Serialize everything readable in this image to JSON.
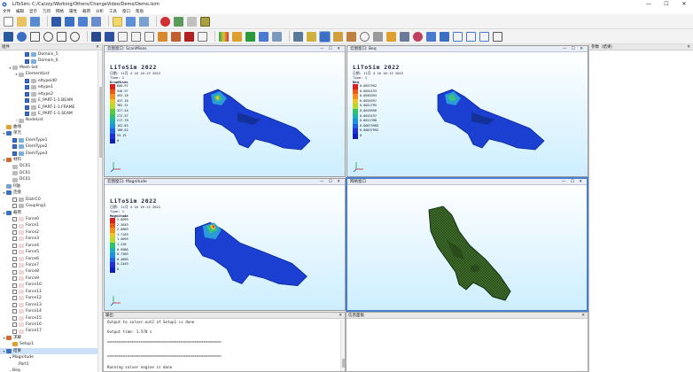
{
  "window": {
    "title": "LiToSim: C:/Ca/zzy/Working/Others/ChangeVideo/Demo/Demo.lsim",
    "min": "—",
    "max": "☐",
    "close": "✕"
  },
  "menu": [
    "文件",
    "编辑",
    "显示",
    "几何",
    "网格",
    "属性",
    "载荷",
    "分析",
    "工具",
    "窗口",
    "帮助"
  ],
  "colors": {
    "accent": "#4a7fd0",
    "bg": "#cdeeff"
  },
  "left_panel": {
    "title": "组件",
    "close": "✕"
  },
  "tree": [
    {
      "label": "Domain_5",
      "indent": 3,
      "cb": "on",
      "icon": "#7ab0e0"
    },
    {
      "label": "Domain_6",
      "indent": 3,
      "cb": "on",
      "icon": "#7ab0e0"
    },
    {
      "label": "Mesh Set",
      "indent": 1,
      "arrow": "▾",
      "icon": "#bcbcbc"
    },
    {
      "label": "ElementList",
      "indent": 2,
      "arrow": "▾",
      "icon": "#bcbcbc"
    },
    {
      "label": "eltypeid0",
      "indent": 3,
      "cb": "on",
      "icon": "#bcbcbc"
    },
    {
      "label": "eltype1",
      "indent": 3,
      "cb": "on",
      "icon": "#bcbcbc"
    },
    {
      "label": "eltype2",
      "indent": 3,
      "cb": "on",
      "icon": "#bcbcbc"
    },
    {
      "label": "E_PART-1-1.BEAM",
      "indent": 3,
      "cb": "on",
      "icon": "#bcbcbc"
    },
    {
      "label": "E_PART-1-1.FRAME",
      "indent": 3,
      "cb": "on",
      "icon": "#bcbcbc"
    },
    {
      "label": "E_PART-1-1.SEAM",
      "indent": 3,
      "cb": "on",
      "icon": "#bcbcbc"
    },
    {
      "label": "NodeList",
      "indent": 2,
      "arrow": "›",
      "icon": "#bcbcbc"
    },
    {
      "label": "曲线",
      "indent": 0,
      "arrow": "",
      "icon": "#e0a030"
    },
    {
      "label": "单元",
      "indent": 0,
      "arrow": "▾",
      "icon": "#3a6fc4"
    },
    {
      "label": "ElemType1",
      "indent": 1,
      "cb": "on",
      "icon": "#7ab0e0"
    },
    {
      "label": "ElemType2",
      "indent": 1,
      "cb": "on",
      "icon": "#7ab0e0"
    },
    {
      "label": "ElemType3",
      "indent": 1,
      "cb": "on",
      "icon": "#7ab0e0"
    },
    {
      "label": "材料",
      "indent": 0,
      "arrow": "▾",
      "icon": "#d26a30"
    },
    {
      "label": "DC01",
      "indent": 1,
      "icon": "#bcbcbc"
    },
    {
      "label": "DC01",
      "indent": 1,
      "icon": "#bcbcbc"
    },
    {
      "label": "DC01",
      "indent": 1,
      "icon": "#bcbcbc"
    },
    {
      "label": "R轴",
      "indent": 0,
      "arrow": "",
      "icon": "#7aa0d0"
    },
    {
      "label": "连接",
      "indent": 0,
      "arrow": "▾",
      "icon": "#3a6fc4"
    },
    {
      "label": "DistrC0",
      "indent": 1,
      "cb": "off",
      "icon": "#bcbcbc"
    },
    {
      "label": "Coupling1",
      "indent": 1,
      "cb": "off",
      "icon": "#bcbcbc"
    },
    {
      "label": "载荷",
      "indent": 0,
      "arrow": "▾",
      "icon": "#3a6fc4"
    },
    {
      "label": "Force0",
      "indent": 1,
      "cb": "off",
      "icon": "#f0d8d8"
    },
    {
      "label": "Force1",
      "indent": 1,
      "cb": "off",
      "icon": "#f0d8d8"
    },
    {
      "label": "Force2",
      "indent": 1,
      "cb": "off",
      "icon": "#f0d8d8"
    },
    {
      "label": "Force3",
      "indent": 1,
      "cb": "off",
      "icon": "#f0d8d8"
    },
    {
      "label": "Force4",
      "indent": 1,
      "cb": "off",
      "icon": "#f0d8d8"
    },
    {
      "label": "Force5",
      "indent": 1,
      "cb": "off",
      "icon": "#f0d8d8"
    },
    {
      "label": "Force6",
      "indent": 1,
      "cb": "off",
      "icon": "#f0d8d8"
    },
    {
      "label": "Force7",
      "indent": 1,
      "cb": "off",
      "icon": "#f0d8d8"
    },
    {
      "label": "Force8",
      "indent": 1,
      "cb": "off",
      "icon": "#f0d8d8"
    },
    {
      "label": "Force9",
      "indent": 1,
      "cb": "off",
      "icon": "#f0d8d8"
    },
    {
      "label": "Force10",
      "indent": 1,
      "cb": "off",
      "icon": "#f0d8d8"
    },
    {
      "label": "Force11",
      "indent": 1,
      "cb": "off",
      "icon": "#f0d8d8"
    },
    {
      "label": "Force12",
      "indent": 1,
      "cb": "off",
      "icon": "#f0d8d8"
    },
    {
      "label": "Force13",
      "indent": 1,
      "cb": "off",
      "icon": "#f0d8d8"
    },
    {
      "label": "Force14",
      "indent": 1,
      "cb": "off",
      "icon": "#f0d8d8"
    },
    {
      "label": "Force15",
      "indent": 1,
      "cb": "off",
      "icon": "#f0d8d8"
    },
    {
      "label": "Force16",
      "indent": 1,
      "cb": "off",
      "icon": "#f0d8d8"
    },
    {
      "label": "Force17",
      "indent": 1,
      "cb": "off",
      "icon": "#f0d8d8"
    },
    {
      "label": "求解",
      "indent": 0,
      "arrow": "▾",
      "icon": "#d26a30"
    },
    {
      "label": "Setup1",
      "indent": 1,
      "icon": "#e0a030"
    },
    {
      "label": "结果",
      "indent": 0,
      "arrow": "▾",
      "icon": "#3a6fc4",
      "selected": true
    },
    {
      "label": "Magnitude",
      "indent": 1,
      "arrow": "▾",
      "icon": ""
    },
    {
      "label": "Part1",
      "indent": 2,
      "icon": ""
    },
    {
      "label": "Beq",
      "indent": 1,
      "arrow": "›",
      "icon": ""
    }
  ],
  "right_panel": {
    "title": "参数（结果）",
    "close": "✕"
  },
  "viewports": [
    {
      "title": "云图窗口: ScanMises",
      "ctl": "— ☐ ✕",
      "app": "LiToSim 2022",
      "date": "日期: 11月 4 16 16:13 2022",
      "time": "Time: 1",
      "var": "DropMises",
      "legend": [
        "600.97",
        "546.97",
        "492.18",
        "437.18",
        "382.31",
        "327.44",
        "272.57",
        "217.70",
        "162.83",
        "108.02",
        "53.15",
        "0"
      ]
    },
    {
      "title": "云图窗口: Beq",
      "ctl": "— ☐ ✕",
      "app": "LiToSim 2022",
      "date": "日期: 11月 4 16 16:13 2022",
      "time": "Time: 1",
      "var": "Beq",
      "legend": [
        "0.0037992",
        "0.0034193",
        "0.0030393",
        "0.0026597",
        "0.0022795",
        "0.0018996",
        "0.0015197",
        "0.0011398",
        "0.00075985",
        "0.00037992",
        "0"
      ]
    },
    {
      "title": "云图窗口: Magnitude",
      "ctl": "— ☐ ✕",
      "app": "LiToSim 2022",
      "date": "日期: 11月 4 16 16:13 2022",
      "time": "Time: 1",
      "var": "Magnitude",
      "legend": [
        "2.6099",
        "2.3849",
        "2.0009",
        "1.7169",
        "1.4699",
        "1.228",
        "0.9986",
        "0.7369",
        "0.4899",
        "0.2449",
        "0"
      ]
    },
    {
      "title": "网格窗口",
      "ctl": "— ☐ ✕"
    }
  ],
  "console": {
    "title": "输出",
    "close": "✕",
    "lines": [
      "Output to solver.out2 of Setup1 is done",
      "",
      "Output time:  1.570 s",
      "",
      "===================================================",
      "",
      "",
      "===================================================",
      "",
      "",
      "Running solver engine is done"
    ]
  },
  "info": {
    "title": "信息面板",
    "close": "✕"
  }
}
